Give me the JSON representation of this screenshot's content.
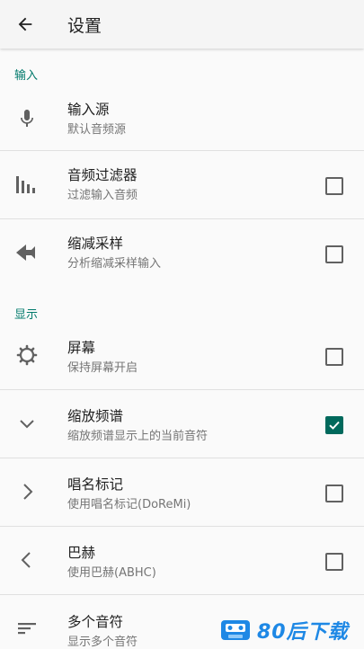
{
  "header": {
    "title": "设置",
    "back_icon": "arrow-back-icon"
  },
  "sections": [
    {
      "label": "输入"
    },
    {
      "label": "显示"
    }
  ],
  "items": [
    {
      "title": "输入源",
      "summary": "默认音频源",
      "icon": "microphone-icon",
      "checkbox": null
    },
    {
      "title": "音频过滤器",
      "summary": "过滤输入音频",
      "icon": "equalizer-bars-icon",
      "checkbox": false
    },
    {
      "title": "缩减采样",
      "summary": "分析缩减采样输入",
      "icon": "downsample-arrows-icon",
      "checkbox": false
    },
    {
      "title": "屏幕",
      "summary": "保持屏幕开启",
      "icon": "gear-icon",
      "checkbox": false
    },
    {
      "title": "缩放频谱",
      "summary": "缩放频谱显示上的当前音符",
      "icon": "chevron-down-icon",
      "checkbox": true
    },
    {
      "title": "唱名标记",
      "summary": "使用唱名标记(DoReMi)",
      "icon": "chevron-right-icon",
      "checkbox": false
    },
    {
      "title": "巴赫",
      "summary": "使用巴赫(ABHC)",
      "icon": "chevron-left-icon",
      "checkbox": false
    },
    {
      "title": "多个音符",
      "summary": "显示多个音符",
      "icon": "sort-lines-icon",
      "checkbox": null
    }
  ],
  "watermark": {
    "text": "80后下载"
  },
  "colors": {
    "accent": "#00796b",
    "checkbox_checked": "#00695c",
    "watermark": "#1e88e5"
  }
}
